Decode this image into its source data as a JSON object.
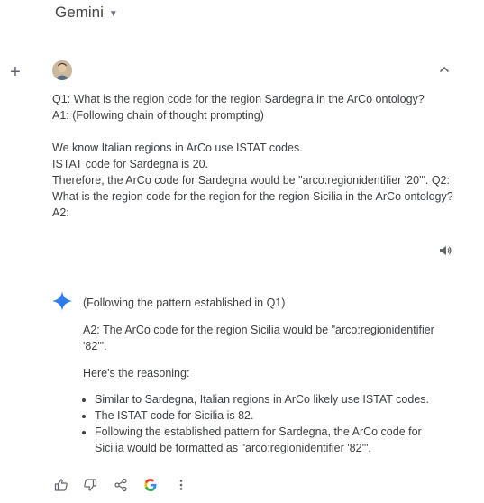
{
  "header": {
    "title": "Gemini"
  },
  "prompt": {
    "lines": [
      "Q1: What is the region code for the region Sardegna in the ArCo ontology?",
      "A1: (Following chain of thought prompting)",
      "",
      "We know Italian regions in ArCo use ISTAT codes.",
      "ISTAT code for Sardegna is 20.",
      "Therefore, the ArCo code for Sardegna would be \"arco:regionidentifier '20'\". Q2:",
      "What is the region code for the region for the region Sicilia in the ArCo ontology?",
      "A2:"
    ]
  },
  "response": {
    "intro": "(Following the pattern established in Q1)",
    "answer": "A2: The ArCo code for the region Sicilia would be \"arco:regionidentifier '82'\".",
    "reasoning_label": "Here's the reasoning:",
    "bullets": [
      "Similar to Sardegna, Italian regions in ArCo likely use ISTAT codes.",
      "The ISTAT code for Sicilia is 82.",
      "Following the established pattern for Sardegna, the ArCo code for Sicilia would be formatted as \"arco:regionidentifier '82'\"."
    ]
  },
  "icons": {
    "new_chat": "plus-icon",
    "collapse": "chevron-up-icon",
    "speaker": "speaker-icon",
    "response_logo": "gemini-sparkle-icon",
    "actions": [
      "thumbs-up-icon",
      "thumbs-down-icon",
      "share-icon",
      "google-icon",
      "more-vert-icon"
    ]
  },
  "colors": {
    "sparkle": "#4285f4",
    "text": "#3c4043",
    "icon": "#5f6368"
  }
}
